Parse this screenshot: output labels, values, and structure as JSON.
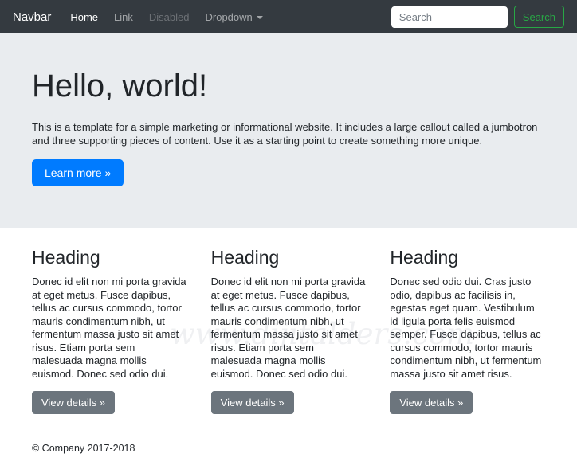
{
  "navbar": {
    "brand": "Navbar",
    "items": [
      {
        "label": "Home",
        "state": "active"
      },
      {
        "label": "Link",
        "state": "normal"
      },
      {
        "label": "Disabled",
        "state": "disabled"
      },
      {
        "label": "Dropdown",
        "state": "dropdown"
      }
    ],
    "search": {
      "placeholder": "Search",
      "button_label": "Search"
    }
  },
  "jumbotron": {
    "title": "Hello, world!",
    "description": "This is a template for a simple marketing or informational website. It includes a large callout called a jumbotron and three supporting pieces of content. Use it as a starting point to create something more unique.",
    "cta_label": "Learn more »"
  },
  "columns": [
    {
      "heading": "Heading",
      "text": "Donec id elit non mi porta gravida at eget metus. Fusce dapibus, tellus ac cursus commodo, tortor mauris condimentum nibh, ut fermentum massa justo sit amet risus. Etiam porta sem malesuada magna mollis euismod. Donec sed odio dui.",
      "button_label": "View details »"
    },
    {
      "heading": "Heading",
      "text": "Donec id elit non mi porta gravida at eget metus. Fusce dapibus, tellus ac cursus commodo, tortor mauris condimentum nibh, ut fermentum massa justo sit amet risus. Etiam porta sem malesuada magna mollis euismod. Donec sed odio dui.",
      "button_label": "View details »"
    },
    {
      "heading": "Heading",
      "text": "Donec sed odio dui. Cras justo odio, dapibus ac facilisis in, egestas eget quam. Vestibulum id ligula porta felis euismod semper. Fusce dapibus, tellus ac cursus commodo, tortor mauris condimentum nibh, ut fermentum massa justo sit amet risus.",
      "button_label": "View details »"
    }
  ],
  "footer": {
    "copyright": "© Company 2017-2018"
  },
  "watermark": "www.dijitalders.com",
  "colors": {
    "navbar_bg": "#343a40",
    "jumbotron_bg": "#e9ecef",
    "primary": "#007bff",
    "secondary": "#6c757d",
    "success_outline": "#28a745",
    "body_text": "#212529"
  }
}
